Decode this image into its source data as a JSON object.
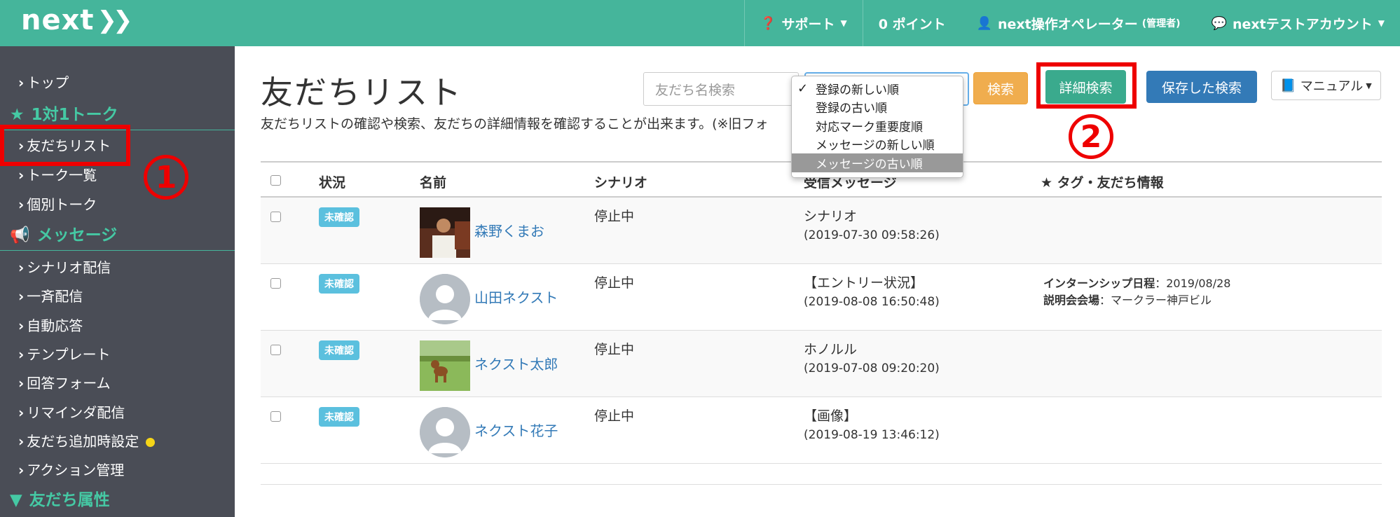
{
  "app": {
    "logo_text": "next",
    "logo_chevrons": "❯❯"
  },
  "topnav": {
    "support": "サポート",
    "points": "0 ポイント",
    "operator": "next操作オペレーター",
    "operator_role": "(管理者)",
    "account": "nextテストアカウント"
  },
  "sidebar": {
    "top": "トップ",
    "section_talk": "1対1トーク",
    "friend_list": "友だちリスト",
    "talk_list": "トーク一覧",
    "individual_talk": "個別トーク",
    "section_message": "メッセージ",
    "scenario": "シナリオ配信",
    "broadcast": "一斉配信",
    "auto_reply": "自動応答",
    "template": "テンプレート",
    "answer_form": "回答フォーム",
    "reminder": "リマインダ配信",
    "friend_add_settings": "友だち追加時設定",
    "action_manage": "アクション管理",
    "section_attr": "友だち属性"
  },
  "annotations": {
    "one": "1",
    "two": "2"
  },
  "main": {
    "title": "友だちリスト",
    "description": "友だちリストの確認や検索、友だちの詳細情報を確認することが出来ます。(※旧フォ",
    "search_placeholder": "友だち名検索",
    "search_button": "検索",
    "detail_search_button": "詳細検索",
    "saved_search_button": "保存した検索",
    "manual_button": "マニュアル"
  },
  "sort_dropdown": {
    "selected": "登録の新しい順",
    "highlighted": "メッセージの古い順",
    "options": [
      "登録の新しい順",
      "登録の古い順",
      "対応マーク重要度順",
      "メッセージの新しい順",
      "メッセージの古い順"
    ]
  },
  "table": {
    "headers": {
      "status": "状況",
      "name": "名前",
      "scenario": "シナリオ",
      "message": "受信メッセージ",
      "tags": "★ タグ・友だち情報"
    },
    "rows": [
      {
        "status": "未確認",
        "name": "森野くまお",
        "scenario": "停止中",
        "message": "シナリオ",
        "time": "(2019-07-30 09:58:26)"
      },
      {
        "status": "未確認",
        "name": "山田ネクスト",
        "scenario": "停止中",
        "message": "【エントリー状況】",
        "time": "(2019-08-08 16:50:48)",
        "tags": [
          {
            "label": "インターンシップ日程",
            "value": "2019/08/28"
          },
          {
            "label": "説明会会場",
            "value": "マークラー神戸ビル"
          }
        ]
      },
      {
        "status": "未確認",
        "name": "ネクスト太郎",
        "scenario": "停止中",
        "message": "ホノルル",
        "time": "(2019-07-08 09:20:20)"
      },
      {
        "status": "未確認",
        "name": "ネクスト花子",
        "scenario": "停止中",
        "message": "【画像】",
        "time": "(2019-08-19 13:46:12)"
      }
    ]
  },
  "colors": {
    "brand": "#45b59b",
    "sidebar": "#4a4d56",
    "annotation": "#ee0000",
    "link": "#337ab7",
    "badge": "#5bc0de"
  }
}
